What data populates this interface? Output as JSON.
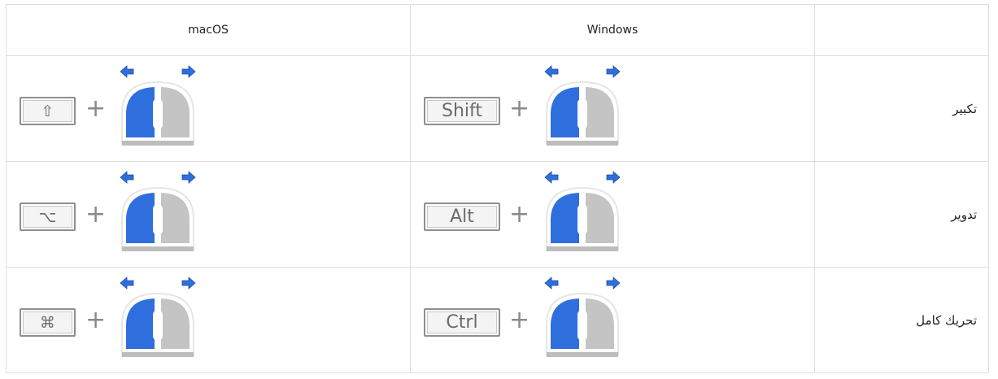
{
  "header": {
    "macos": "macOS",
    "windows": "Windows",
    "action": ""
  },
  "rows": [
    {
      "action": "تكبير",
      "mac_key": "⇧",
      "mac_key_icon": "shift-arrow-icon",
      "win_key": "Shift",
      "plus": "+"
    },
    {
      "action": "تدوير",
      "mac_key": "⌥",
      "mac_key_icon": "option-icon",
      "win_key": "Alt",
      "plus": "+"
    },
    {
      "action": "تحريك كامل",
      "mac_key": "⌘",
      "mac_key_icon": "command-icon",
      "win_key": "Ctrl",
      "plus": "+"
    }
  ],
  "mouse_icon": "mouse-left-drag-icon",
  "colors": {
    "accent_blue": "#2f6fdd",
    "mouse_gray": "#c4c4c4",
    "border": "#dedede"
  }
}
